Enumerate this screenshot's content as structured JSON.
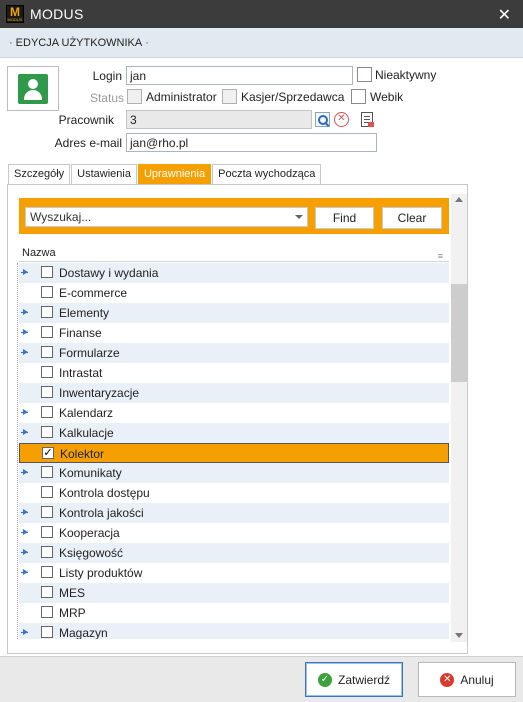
{
  "window": {
    "title": "MODUS",
    "logo_letter": "M",
    "logo_subtext": "MODUS"
  },
  "section": {
    "title": "EDYCJA UŻYTKOWNIKA"
  },
  "form": {
    "login_label": "Login",
    "login_value": "jan",
    "inactive_label": "Nieaktywny",
    "status_label": "Status",
    "administrator_label": "Administrator",
    "cashier_label": "Kasjer/Sprzedawca",
    "webik_label": "Webik",
    "employee_label": "Pracownik",
    "employee_value": "3",
    "email_label": "Adres e-mail",
    "email_value": "jan@rho.pl"
  },
  "tabs": [
    {
      "label": "Szczegóły",
      "active": false
    },
    {
      "label": "Ustawienia",
      "active": false
    },
    {
      "label": "Uprawnienia",
      "active": true
    },
    {
      "label": "Poczta wychodząca",
      "active": false
    }
  ],
  "search": {
    "placeholder": "Wyszukaj...",
    "find_label": "Find",
    "clear_label": "Clear"
  },
  "grid": {
    "column_header": "Nazwa",
    "rows": [
      {
        "label": "Dostawy i wydania",
        "expandable": true,
        "checked": false
      },
      {
        "label": "E-commerce",
        "expandable": false,
        "checked": false
      },
      {
        "label": "Elementy",
        "expandable": true,
        "checked": false
      },
      {
        "label": "Finanse",
        "expandable": true,
        "checked": false
      },
      {
        "label": "Formularze",
        "expandable": true,
        "checked": false
      },
      {
        "label": "Intrastat",
        "expandable": false,
        "checked": false
      },
      {
        "label": "Inwentaryzacje",
        "expandable": false,
        "checked": false
      },
      {
        "label": "Kalendarz",
        "expandable": true,
        "checked": false
      },
      {
        "label": "Kalkulacje",
        "expandable": true,
        "checked": false
      },
      {
        "label": "Kolektor",
        "expandable": false,
        "checked": true,
        "selected": true
      },
      {
        "label": "Komunikaty",
        "expandable": true,
        "checked": false
      },
      {
        "label": "Kontrola dostępu",
        "expandable": false,
        "checked": false
      },
      {
        "label": "Kontrola jakości",
        "expandable": true,
        "checked": false
      },
      {
        "label": "Kooperacja",
        "expandable": true,
        "checked": false
      },
      {
        "label": "Księgowość",
        "expandable": true,
        "checked": false
      },
      {
        "label": "Listy produktów",
        "expandable": true,
        "checked": false
      },
      {
        "label": "MES",
        "expandable": false,
        "checked": false
      },
      {
        "label": "MRP",
        "expandable": false,
        "checked": false
      },
      {
        "label": "Magazyn",
        "expandable": true,
        "checked": false
      }
    ]
  },
  "footer": {
    "confirm_label": "Zatwierdź",
    "cancel_label": "Anuluj"
  },
  "colors": {
    "accent": "#f5a000",
    "titlebar": "#3c3c3c",
    "row_alt": "#e9f0f7",
    "avatar": "#2f9a49"
  }
}
